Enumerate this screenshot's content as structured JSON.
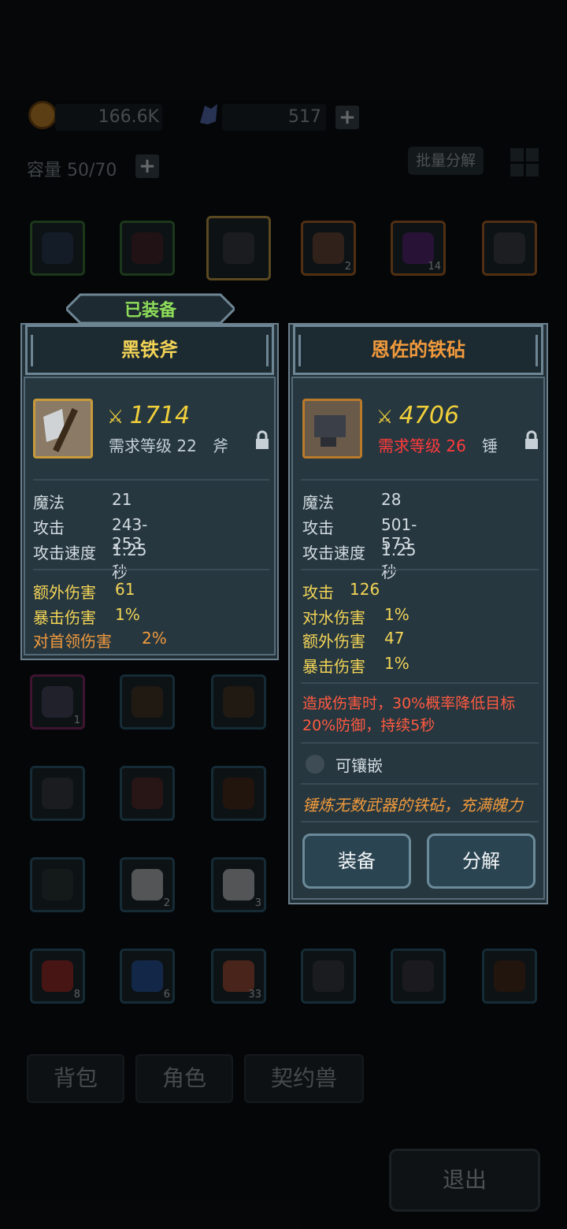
{
  "resources": {
    "gold": "166.6K",
    "crystal": "517"
  },
  "capacity": "容量 50/70",
  "batch_label": "批量分解",
  "inventory_counts": {
    "mushroom": "2",
    "amethyst": "14",
    "gem_ring": "1",
    "pants1": "2",
    "pants2": "3",
    "potion_red": "8",
    "potion_blue": "6",
    "meat": "33"
  },
  "tabs": [
    "背包",
    "角色",
    "契约兽"
  ],
  "exit_label": "退出",
  "equipped_badge": "已装备",
  "left_card": {
    "name": "黑铁斧",
    "power": "1714",
    "requirement": "需求等级 22",
    "type": "斧",
    "stats": [
      {
        "label": "魔法",
        "value": "21"
      },
      {
        "label": "攻击",
        "value": "243-253"
      },
      {
        "label": "攻击速度",
        "value": "1.25秒"
      }
    ],
    "bonus": [
      {
        "label": "额外伤害",
        "value": "61"
      },
      {
        "label": "暴击伤害",
        "value": "1%"
      },
      {
        "label": "对首领伤害",
        "value": "2%"
      }
    ]
  },
  "right_card": {
    "name": "恩佐的铁砧",
    "power": "4706",
    "requirement": "需求等级 26",
    "type": "锤",
    "stats": [
      {
        "label": "魔法",
        "value": "28"
      },
      {
        "label": "攻击",
        "value": "501-573"
      },
      {
        "label": "攻击速度",
        "value": "1.25秒"
      }
    ],
    "bonus": [
      {
        "label": "攻击",
        "value": "126"
      },
      {
        "label": "对水伤害",
        "value": "1%"
      },
      {
        "label": "额外伤害",
        "value": "47"
      },
      {
        "label": "暴击伤害",
        "value": "1%"
      }
    ],
    "effect_line1": "造成伤害时，30%概率降低目标",
    "effect_line2": "20%防御，持续5秒",
    "socket": "可镶嵌",
    "flavor": "锤炼无数武器的铁砧，充满魄力",
    "equip_btn": "装备",
    "dismantle_btn": "分解"
  },
  "colors": {
    "gold_text": "#f3d456",
    "orange_text": "#f19a3c",
    "red_text": "#ff3b3b",
    "panel_bg": "#223038"
  }
}
